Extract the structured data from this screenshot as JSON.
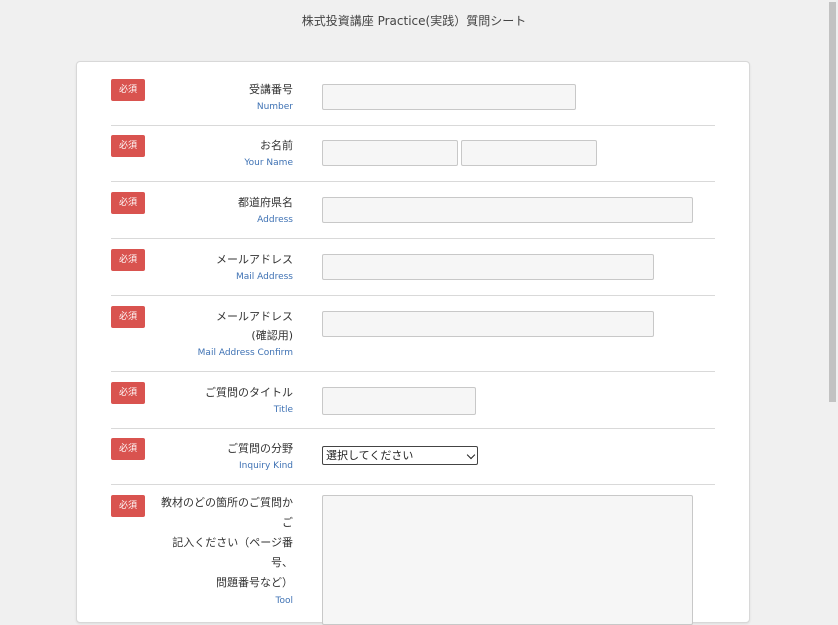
{
  "page": {
    "title": "株式投資講座 Practice(実践）質問シート"
  },
  "required_label": "必須",
  "fields": [
    {
      "label_ja": "受講番号",
      "label_en": "Number"
    },
    {
      "label_ja": "お名前",
      "label_en": "Your Name"
    },
    {
      "label_ja": "都道府県名",
      "label_en": "Address"
    },
    {
      "label_ja": "メールアドレス",
      "label_en": "Mail Address"
    },
    {
      "label_ja_line1": "メールアドレス",
      "label_ja_line2": "(確認用)",
      "label_en": "Mail Address Confirm"
    },
    {
      "label_ja": "ご質問のタイトル",
      "label_en": "Title"
    },
    {
      "label_ja": "ご質問の分野",
      "label_en": "Inquiry Kind",
      "select_value": "選択してください"
    },
    {
      "label_ja_line1": "教材のどの箇所のご質問かご",
      "label_ja_line2": "記入ください（ページ番号、",
      "label_ja_line3": "問題番号など）",
      "label_en": "Tool"
    }
  ],
  "colors": {
    "required_badge": "#d9534f",
    "english_label": "#3f72b4"
  }
}
